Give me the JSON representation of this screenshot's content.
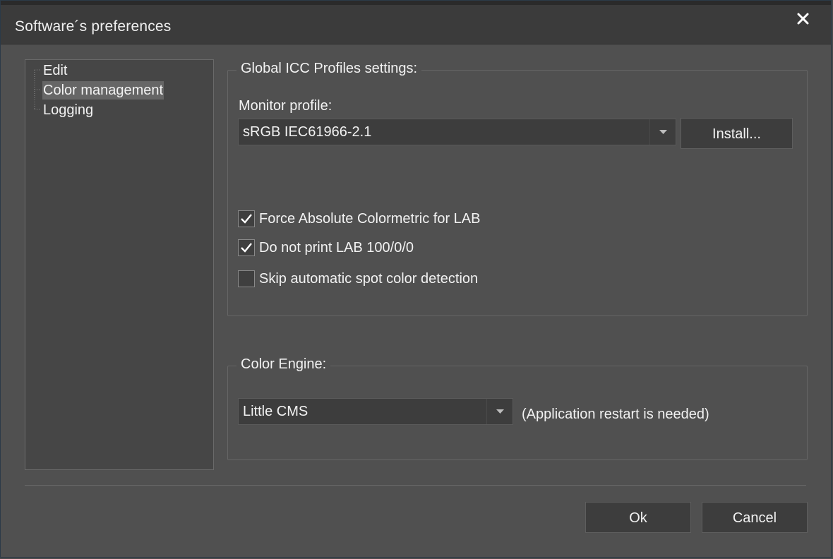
{
  "window": {
    "title": "Software´s preferences"
  },
  "tree": {
    "items": [
      {
        "label": "Edit",
        "selected": false
      },
      {
        "label": "Color management",
        "selected": true
      },
      {
        "label": "Logging",
        "selected": false
      }
    ]
  },
  "icc": {
    "group_title": "Global ICC Profiles settings:",
    "monitor_label": "Monitor profile:",
    "monitor_value": "sRGB IEC61966-2.1",
    "install_label": "Install...",
    "checkboxes": [
      {
        "label": "Force Absolute Colormetric for LAB",
        "checked": true
      },
      {
        "label": "Do not print LAB 100/0/0",
        "checked": true
      },
      {
        "label": "Skip automatic spot color detection",
        "checked": false
      }
    ]
  },
  "engine": {
    "group_title": "Color Engine:",
    "value": "Little CMS",
    "note": "(Application restart is needed)"
  },
  "footer": {
    "ok_label": "Ok",
    "cancel_label": "Cancel"
  },
  "icons": {
    "close": "close-icon",
    "dropdown": "chevron-down-icon",
    "check": "checkmark-icon"
  },
  "colors": {
    "background": "#505050",
    "titlebar": "#3b3b3b",
    "selection": "#666666",
    "text": "#f2f2f2"
  }
}
